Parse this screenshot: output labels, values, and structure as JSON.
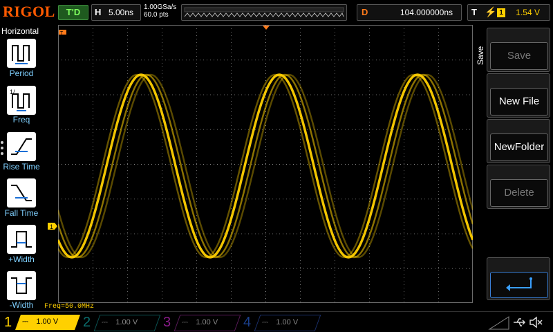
{
  "top": {
    "logo": "RIGOL",
    "trigger_status": "T'D",
    "horizontal_key": "H",
    "timebase": "5.00ns",
    "sample_rate": "1.00GSa/s",
    "memory_depth": "60.0 pts",
    "delay_key": "D",
    "delay_value": "104.000000ns",
    "trigger_key": "T",
    "trigger_channel": "1",
    "trigger_level": "1.54 V"
  },
  "left_menu": {
    "title": "Horizontal",
    "items": [
      {
        "label": "Period",
        "icon": "period-icon"
      },
      {
        "label": "Freq",
        "icon": "freq-icon"
      },
      {
        "label": "Rise Time",
        "icon": "rise-time-icon"
      },
      {
        "label": "Fall Time",
        "icon": "fall-time-icon"
      },
      {
        "label": "+Width",
        "icon": "positive-width-icon"
      },
      {
        "label": "-Width",
        "icon": "negative-width-icon"
      }
    ]
  },
  "right_menu": {
    "title": "Save",
    "items": [
      {
        "label": "Save",
        "enabled": false
      },
      {
        "label": "New File",
        "enabled": true
      },
      {
        "label": "NewFolder",
        "enabled": true
      },
      {
        "label": "Delete",
        "enabled": false
      },
      {
        "label": "",
        "icon": "enter-icon"
      }
    ]
  },
  "measurement": "Freq=50.0MHz",
  "channels": [
    {
      "num": "1",
      "scale": "1.00 V",
      "color": "#ffd000",
      "active": true
    },
    {
      "num": "2",
      "scale": "1.00 V",
      "color": "#00a0a0",
      "active": false
    },
    {
      "num": "3",
      "scale": "1.00 V",
      "color": "#c000c0",
      "active": false
    },
    {
      "num": "4",
      "scale": "1.00 V",
      "color": "#1060e0",
      "active": false
    }
  ],
  "markers": {
    "trigger_pos": "T",
    "trigger_level": "T",
    "ch1": "1"
  },
  "colors": {
    "ch1": "#ffd000",
    "accent": "#ff7a1a",
    "grid": "#6a6a6a"
  }
}
